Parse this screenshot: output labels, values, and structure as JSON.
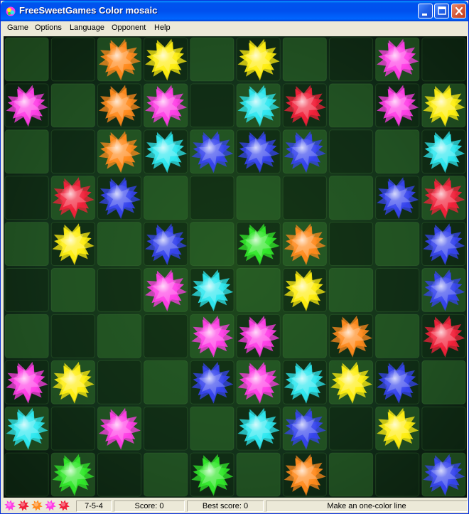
{
  "window": {
    "title": "FreeSweetGames Color mosaic"
  },
  "menu": [
    "Game",
    "Options",
    "Language",
    "Opponent",
    "Help"
  ],
  "colors": {
    "orange": "#ff8a1c",
    "yellow": "#ffee10",
    "magenta": "#ff3ee6",
    "cyan": "#2ee8f0",
    "red": "#f2203a",
    "blue": "#3644ee",
    "green": "#31e82a"
  },
  "board": {
    "rows": 10,
    "cols": 10,
    "cells": [
      [
        "",
        "",
        "orange",
        "yellow",
        "",
        "yellow",
        "",
        "",
        "magenta",
        ""
      ],
      [
        "magenta",
        "",
        "orange",
        "magenta",
        "",
        "cyan",
        "red",
        "",
        "magenta",
        "yellow"
      ],
      [
        "",
        "",
        "orange",
        "cyan",
        "blue",
        "blue",
        "blue",
        "",
        "",
        "cyan"
      ],
      [
        "",
        "red",
        "blue",
        "",
        "",
        "",
        "",
        "",
        "blue",
        "red"
      ],
      [
        "",
        "yellow",
        "",
        "blue",
        "",
        "green",
        "orange",
        "",
        "",
        "blue"
      ],
      [
        "",
        "",
        "",
        "magenta",
        "cyan",
        "",
        "yellow",
        "",
        "",
        "blue"
      ],
      [
        "",
        "",
        "",
        "",
        "magenta",
        "magenta",
        "",
        "orange",
        "",
        "red"
      ],
      [
        "magenta",
        "yellow",
        "",
        "",
        "blue",
        "magenta",
        "cyan",
        "yellow",
        "blue",
        ""
      ],
      [
        "cyan",
        "",
        "magenta",
        "",
        "",
        "cyan",
        "blue",
        "",
        "yellow",
        ""
      ],
      [
        "",
        "green",
        "",
        "",
        "green",
        "",
        "orange",
        "",
        "",
        "blue"
      ]
    ]
  },
  "status": {
    "next_colors": [
      "magenta",
      "red",
      "orange",
      "magenta",
      "red"
    ],
    "level": "7-5-4",
    "score": "Score: 0",
    "best_score": "Best score: 0",
    "hint": "Make an one-color line"
  }
}
